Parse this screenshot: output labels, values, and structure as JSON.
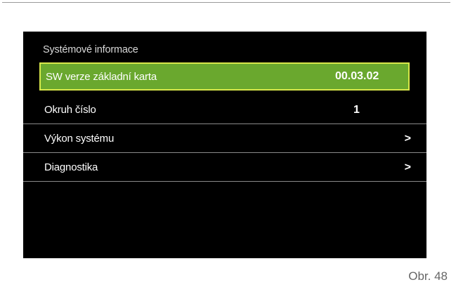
{
  "screen": {
    "title": "Systémové informace",
    "rows": [
      {
        "label": "SW verze základní karta",
        "value": "00.03.02",
        "selected": true
      },
      {
        "label": "Okruh číslo",
        "value": "1"
      },
      {
        "label": "Výkon systému",
        "chevron": ">"
      },
      {
        "label": "Diagnostika",
        "chevron": ">"
      }
    ]
  },
  "caption": "Obr. 48",
  "colors": {
    "selected_bg": "#6aa82e",
    "selected_border": "#d8e84a",
    "screen_bg": "#000000"
  }
}
